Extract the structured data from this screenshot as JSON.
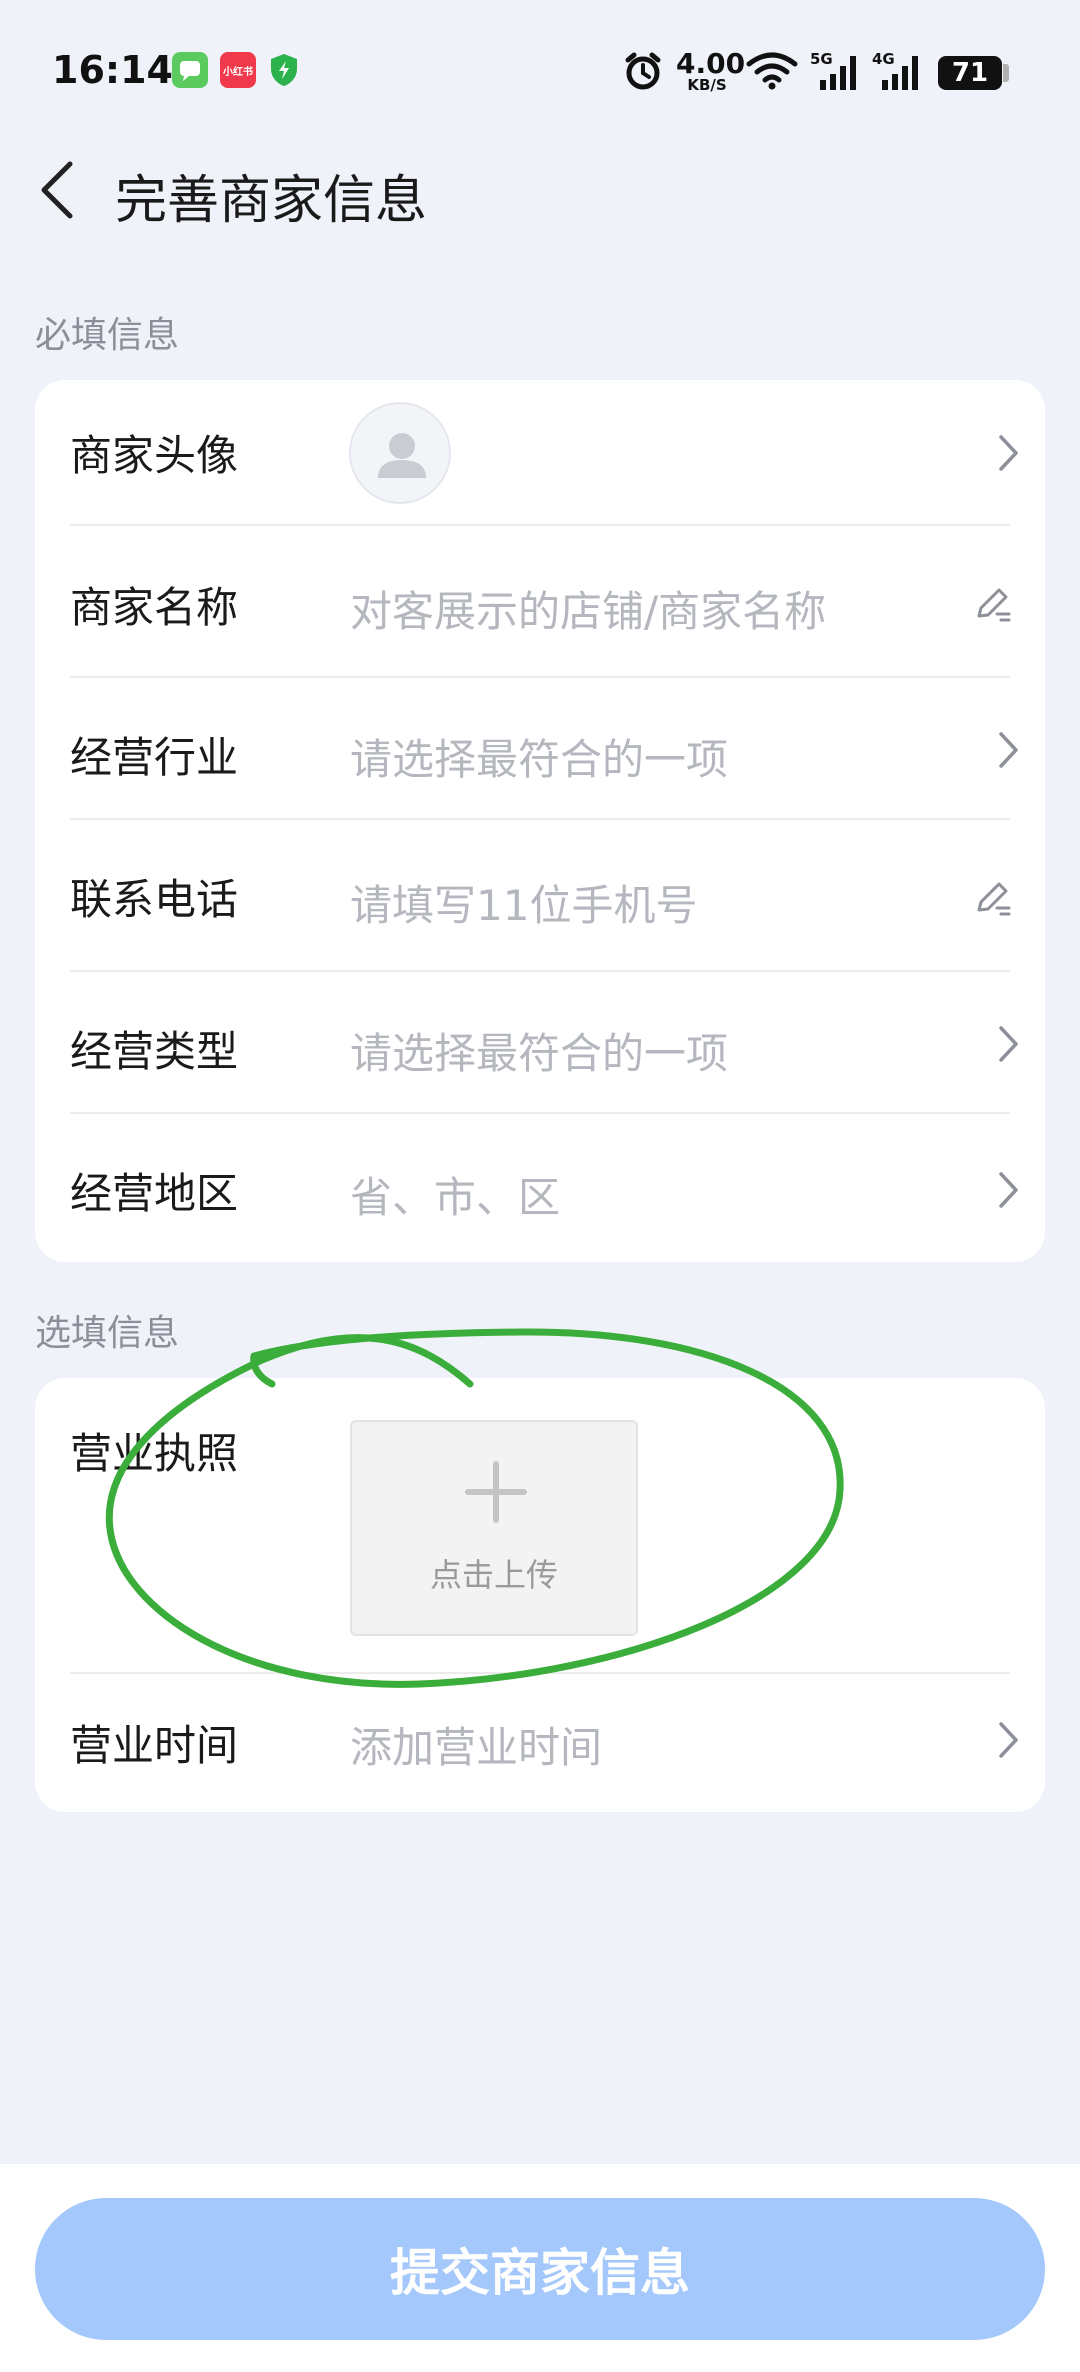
{
  "status_bar": {
    "time": "16:14",
    "notif_badge_text": "小红书",
    "net_speed_value": "4.00",
    "net_speed_unit": "KB/S",
    "signal_1": "5G",
    "signal_2": "4G",
    "battery": "71",
    "icons": [
      "messages-icon",
      "xiaohongshu-icon",
      "security-shield-icon",
      "alarm-icon",
      "wifi-icon",
      "cell-signal-icon",
      "battery-icon"
    ]
  },
  "header": {
    "title": "完善商家信息"
  },
  "required": {
    "label": "必填信息",
    "rows": [
      {
        "label": "商家头像",
        "value": ""
      },
      {
        "label": "商家名称",
        "value": "对客展示的店铺/商家名称"
      },
      {
        "label": "经营行业",
        "value": "请选择最符合的一项"
      },
      {
        "label": "联系电话",
        "value": "请填写11位手机号"
      },
      {
        "label": "经营类型",
        "value": "请选择最符合的一项"
      },
      {
        "label": "经营地区",
        "value": "省、市、区"
      }
    ]
  },
  "optional": {
    "label": "选填信息",
    "license_label": "营业执照",
    "upload_text": "点击上传",
    "hours_label": "营业时间",
    "hours_value": "添加营业时间"
  },
  "submit_label": "提交商家信息",
  "colors": {
    "background": "#eff2f8",
    "card": "#ffffff",
    "placeholder": "#b4b7bd",
    "submit_button": "#a4c8fb",
    "annotation_circle": "#3aad3a"
  }
}
